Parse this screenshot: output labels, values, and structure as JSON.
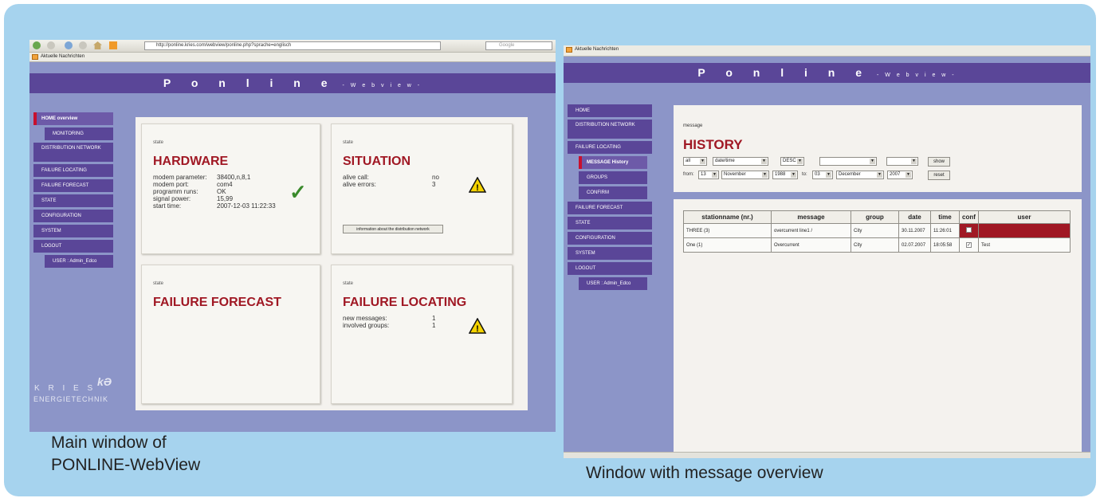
{
  "left": {
    "url": "http://ponline.kries.com/webview/ponline.php?sprache=englisch",
    "search_placeholder": "Google",
    "bookmark": "Aktuelle Nachrichten",
    "title": "P o n l i n e",
    "subtitle": "- W e b v i e w -",
    "nav": [
      "HOME overview",
      "MONITORING",
      "DISTRIBUTION NETWORK",
      "FAILURE LOCATING",
      "FAILURE FORECAST",
      "STATE",
      "CONFIGURATION",
      "SYSTEM",
      "LOGOUT",
      "USER : Admin_Edco"
    ],
    "hardware": {
      "state": "state",
      "title": "HARDWARE",
      "rows": [
        [
          "modem parameter:",
          "38400,n,8,1"
        ],
        [
          "modem port:",
          "com4"
        ],
        [
          "programm runs:",
          "OK"
        ],
        [
          "signal power:",
          "15,99"
        ],
        [
          "start time:",
          "2007-12-03 11:22:33"
        ]
      ]
    },
    "situation": {
      "state": "state",
      "title": "SITUATION",
      "rows": [
        [
          "alive call:",
          "no"
        ],
        [
          "alive errors:",
          "3"
        ]
      ],
      "button": "information about the distribution network"
    },
    "forecast": {
      "state": "state",
      "title": "FAILURE FORECAST"
    },
    "locating": {
      "state": "state",
      "title": "FAILURE LOCATING",
      "rows": [
        [
          "new messages:",
          "1"
        ],
        [
          "involved groups:",
          "1"
        ]
      ]
    },
    "logo_line1": "K R I E S",
    "logo_line2": "ENERGIETECHNIK"
  },
  "right": {
    "bookmark": "Aktuelle Nachrichten",
    "title": "P o n l i n e",
    "subtitle": "- W e b v i e w -",
    "nav": [
      "HOME",
      "DISTRIBUTION NETWORK",
      "FAILURE LOCATING",
      "MESSAGE History",
      "GROUPS",
      "CONFIRM",
      "FAILURE FORECAST",
      "STATE",
      "CONFIGURATION",
      "SYSTEM",
      "LOGOUT",
      "USER : Admin_Edco"
    ],
    "message_label": "message",
    "history_title": "HISTORY",
    "filters": {
      "all": "all",
      "field": "date/time",
      "order": "DESC",
      "from_label": "from:",
      "from_day": "13",
      "from_month": "November",
      "from_year": "1988",
      "to_label": "to:",
      "to_day": "03",
      "to_month": "December",
      "to_year": "2007",
      "show": "show",
      "reset": "reset"
    },
    "table": {
      "headers": [
        "stationname (nr.)",
        "message",
        "group",
        "date",
        "time",
        "conf",
        "user"
      ],
      "rows": [
        [
          "THREE (3)",
          "overcurrent line1 /",
          "City",
          "30.11.2007",
          "11:26:01",
          "",
          ""
        ],
        [
          "One (1)",
          "Overcurrent",
          "City",
          "02.07.2007",
          "18:05:58",
          "",
          "Test"
        ]
      ]
    }
  },
  "captions": {
    "left": "Main window of\nPONLINE-WebView",
    "right": "Window with message overview"
  },
  "colors": {
    "frame": "#a6d3ee",
    "header": "#5a4698",
    "accent": "#a01824"
  }
}
